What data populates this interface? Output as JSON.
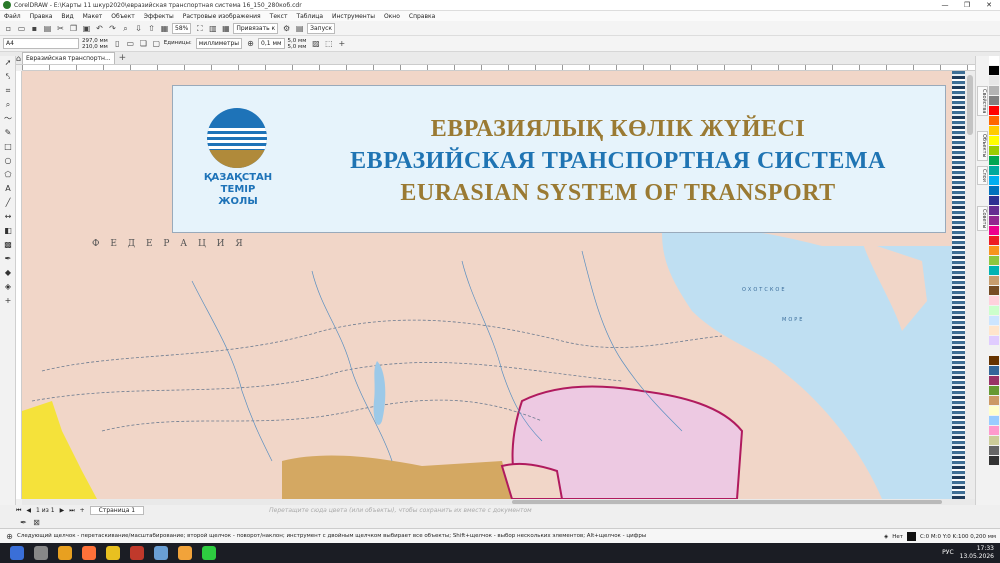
{
  "window": {
    "title": "CorelDRAW - E:\\Карты 11 шкур2020\\евразийская транспортная система 16_150_280коб.cdr",
    "controls": [
      "—",
      "❐",
      "✕"
    ]
  },
  "menu": [
    "Файл",
    "Правка",
    "Вид",
    "Макет",
    "Объект",
    "Эффекты",
    "Растровые изображения",
    "Текст",
    "Таблица",
    "Инструменты",
    "Окно",
    "Справка"
  ],
  "toolbar": {
    "zoom": "58%",
    "snap": "Привязать к",
    "launch": "Запуск"
  },
  "property_bar": {
    "page_size": "A4",
    "width": "297,0 мм",
    "height": "210,0 мм",
    "units_label": "Единицы:",
    "units": "миллиметры",
    "nudge": "0,1 мм",
    "dup_x": "5,0 мм",
    "dup_y": "5,0 мм"
  },
  "document_tab": "Евразийская транспортн...",
  "banner": {
    "logo_text": [
      "ҚАЗАҚСТАН",
      "ТЕМІР",
      "ЖОЛЫ"
    ],
    "title_kz": "ЕВРАЗИЯЛЫҚ КӨЛІК ЖҮЙЕСІ",
    "title_ru": "ЕВРАЗИЙСКАЯ ТРАНСПОРТНАЯ СИСТЕМА",
    "title_en": "EURASIAN SYSTEM OF TRANSPORT",
    "color_gold": "#9a7a33",
    "color_blue": "#1f74b3"
  },
  "map": {
    "region_label": "Ф Е Д Е Р А Ц И Я",
    "sea_label": "ОХОТСКОЕ",
    "sea_label2": "МОРЕ"
  },
  "page_bar": {
    "position": "1 из 1",
    "page_tab": "Страница 1",
    "drag_hint": "Перетащите сюда цвета (или объекты), чтобы сохранить их вместе с документом"
  },
  "status": {
    "hint": "Следующий щелчок - перетаскивание/масштабирование; второй щелчок - поворот/наклон; инструмент с двойным щелчком выбирает все объекты; Shift+щелчок - выбор нескольких элементов; Alt+щелчок - цифры",
    "fill": "Нет",
    "outline": "C:0 M:0 Y:0 K:100  0,200 мм"
  },
  "tray": {
    "lang": "РУС",
    "time": "17:33",
    "date": "13.05.2026"
  },
  "dockers": [
    "Свойства",
    "Объекты",
    "Слои",
    "Советы"
  ],
  "palette": [
    "#ffffff",
    "#000000",
    "#e6e6e6",
    "#b3b3b3",
    "#808080",
    "#ff0000",
    "#ff6600",
    "#ffcc00",
    "#ffff00",
    "#99cc00",
    "#00a651",
    "#00a99d",
    "#00aeef",
    "#0072bc",
    "#2e3192",
    "#662d91",
    "#92278f",
    "#ec008c",
    "#ed1c24",
    "#f7941d",
    "#8dc63f",
    "#00b3b3",
    "#c69c6d",
    "#754c24",
    "#ffd1dc",
    "#ccffcc",
    "#cce5ff",
    "#ffe5cc",
    "#e0ccff",
    "#f2f2f2",
    "#663300",
    "#336699",
    "#993366",
    "#669933",
    "#cc9966",
    "#ffffcc",
    "#99ccff",
    "#ff99cc",
    "#cccc99",
    "#666666",
    "#333333"
  ]
}
